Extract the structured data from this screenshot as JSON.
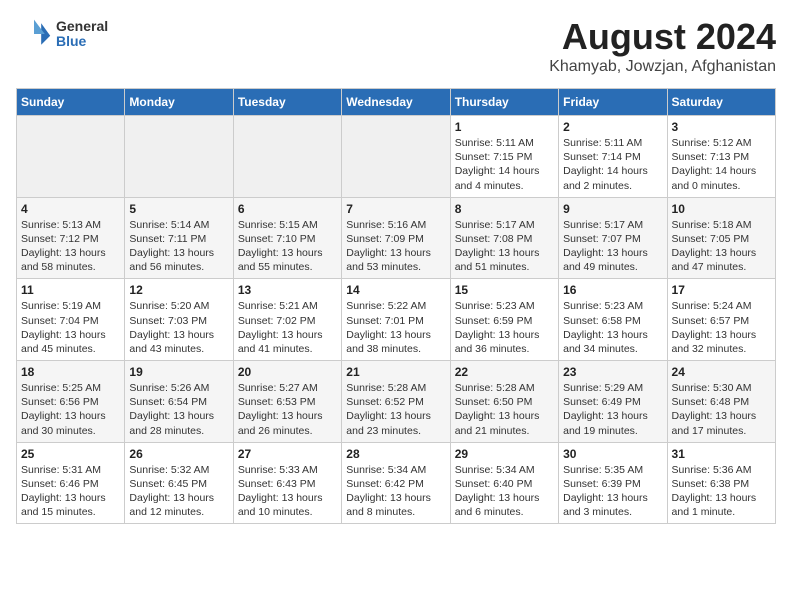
{
  "header": {
    "logo_line1": "General",
    "logo_line2": "Blue",
    "title": "August 2024",
    "subtitle": "Khamyab, Jowzjan, Afghanistan"
  },
  "days_of_week": [
    "Sunday",
    "Monday",
    "Tuesday",
    "Wednesday",
    "Thursday",
    "Friday",
    "Saturday"
  ],
  "weeks": [
    [
      {
        "day": "",
        "info": ""
      },
      {
        "day": "",
        "info": ""
      },
      {
        "day": "",
        "info": ""
      },
      {
        "day": "",
        "info": ""
      },
      {
        "day": "1",
        "info": "Sunrise: 5:11 AM\nSunset: 7:15 PM\nDaylight: 14 hours\nand 4 minutes."
      },
      {
        "day": "2",
        "info": "Sunrise: 5:11 AM\nSunset: 7:14 PM\nDaylight: 14 hours\nand 2 minutes."
      },
      {
        "day": "3",
        "info": "Sunrise: 5:12 AM\nSunset: 7:13 PM\nDaylight: 14 hours\nand 0 minutes."
      }
    ],
    [
      {
        "day": "4",
        "info": "Sunrise: 5:13 AM\nSunset: 7:12 PM\nDaylight: 13 hours\nand 58 minutes."
      },
      {
        "day": "5",
        "info": "Sunrise: 5:14 AM\nSunset: 7:11 PM\nDaylight: 13 hours\nand 56 minutes."
      },
      {
        "day": "6",
        "info": "Sunrise: 5:15 AM\nSunset: 7:10 PM\nDaylight: 13 hours\nand 55 minutes."
      },
      {
        "day": "7",
        "info": "Sunrise: 5:16 AM\nSunset: 7:09 PM\nDaylight: 13 hours\nand 53 minutes."
      },
      {
        "day": "8",
        "info": "Sunrise: 5:17 AM\nSunset: 7:08 PM\nDaylight: 13 hours\nand 51 minutes."
      },
      {
        "day": "9",
        "info": "Sunrise: 5:17 AM\nSunset: 7:07 PM\nDaylight: 13 hours\nand 49 minutes."
      },
      {
        "day": "10",
        "info": "Sunrise: 5:18 AM\nSunset: 7:05 PM\nDaylight: 13 hours\nand 47 minutes."
      }
    ],
    [
      {
        "day": "11",
        "info": "Sunrise: 5:19 AM\nSunset: 7:04 PM\nDaylight: 13 hours\nand 45 minutes."
      },
      {
        "day": "12",
        "info": "Sunrise: 5:20 AM\nSunset: 7:03 PM\nDaylight: 13 hours\nand 43 minutes."
      },
      {
        "day": "13",
        "info": "Sunrise: 5:21 AM\nSunset: 7:02 PM\nDaylight: 13 hours\nand 41 minutes."
      },
      {
        "day": "14",
        "info": "Sunrise: 5:22 AM\nSunset: 7:01 PM\nDaylight: 13 hours\nand 38 minutes."
      },
      {
        "day": "15",
        "info": "Sunrise: 5:23 AM\nSunset: 6:59 PM\nDaylight: 13 hours\nand 36 minutes."
      },
      {
        "day": "16",
        "info": "Sunrise: 5:23 AM\nSunset: 6:58 PM\nDaylight: 13 hours\nand 34 minutes."
      },
      {
        "day": "17",
        "info": "Sunrise: 5:24 AM\nSunset: 6:57 PM\nDaylight: 13 hours\nand 32 minutes."
      }
    ],
    [
      {
        "day": "18",
        "info": "Sunrise: 5:25 AM\nSunset: 6:56 PM\nDaylight: 13 hours\nand 30 minutes."
      },
      {
        "day": "19",
        "info": "Sunrise: 5:26 AM\nSunset: 6:54 PM\nDaylight: 13 hours\nand 28 minutes."
      },
      {
        "day": "20",
        "info": "Sunrise: 5:27 AM\nSunset: 6:53 PM\nDaylight: 13 hours\nand 26 minutes."
      },
      {
        "day": "21",
        "info": "Sunrise: 5:28 AM\nSunset: 6:52 PM\nDaylight: 13 hours\nand 23 minutes."
      },
      {
        "day": "22",
        "info": "Sunrise: 5:28 AM\nSunset: 6:50 PM\nDaylight: 13 hours\nand 21 minutes."
      },
      {
        "day": "23",
        "info": "Sunrise: 5:29 AM\nSunset: 6:49 PM\nDaylight: 13 hours\nand 19 minutes."
      },
      {
        "day": "24",
        "info": "Sunrise: 5:30 AM\nSunset: 6:48 PM\nDaylight: 13 hours\nand 17 minutes."
      }
    ],
    [
      {
        "day": "25",
        "info": "Sunrise: 5:31 AM\nSunset: 6:46 PM\nDaylight: 13 hours\nand 15 minutes."
      },
      {
        "day": "26",
        "info": "Sunrise: 5:32 AM\nSunset: 6:45 PM\nDaylight: 13 hours\nand 12 minutes."
      },
      {
        "day": "27",
        "info": "Sunrise: 5:33 AM\nSunset: 6:43 PM\nDaylight: 13 hours\nand 10 minutes."
      },
      {
        "day": "28",
        "info": "Sunrise: 5:34 AM\nSunset: 6:42 PM\nDaylight: 13 hours\nand 8 minutes."
      },
      {
        "day": "29",
        "info": "Sunrise: 5:34 AM\nSunset: 6:40 PM\nDaylight: 13 hours\nand 6 minutes."
      },
      {
        "day": "30",
        "info": "Sunrise: 5:35 AM\nSunset: 6:39 PM\nDaylight: 13 hours\nand 3 minutes."
      },
      {
        "day": "31",
        "info": "Sunrise: 5:36 AM\nSunset: 6:38 PM\nDaylight: 13 hours\nand 1 minute."
      }
    ]
  ]
}
